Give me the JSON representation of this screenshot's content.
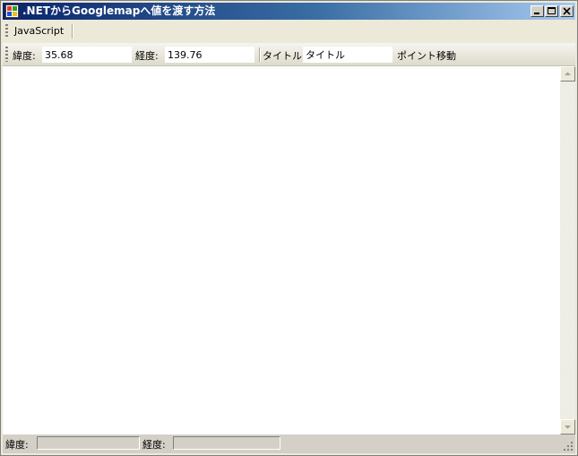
{
  "window": {
    "title": ".NETからGooglemapへ値を渡す方法"
  },
  "menu": {
    "items": [
      "JavaScript"
    ]
  },
  "toolbar": {
    "latitude_label": "緯度:",
    "latitude_value": "35.68",
    "longitude_label": "経度:",
    "longitude_value": "139.76",
    "title_label": "タイトル:",
    "title_value": "タイトル",
    "move_button": "ポイント移動"
  },
  "status": {
    "latitude_label": "緯度:",
    "latitude_value": "",
    "longitude_label": "経度:",
    "longitude_value": ""
  },
  "icons": [
    "app-icon",
    "minimize-icon",
    "maximize-icon",
    "close-icon",
    "scroll-up-icon",
    "scroll-down-icon",
    "size-grip-icon"
  ],
  "colors": {
    "titlebar_start": "#0a246a",
    "titlebar_end": "#a6caf0"
  }
}
